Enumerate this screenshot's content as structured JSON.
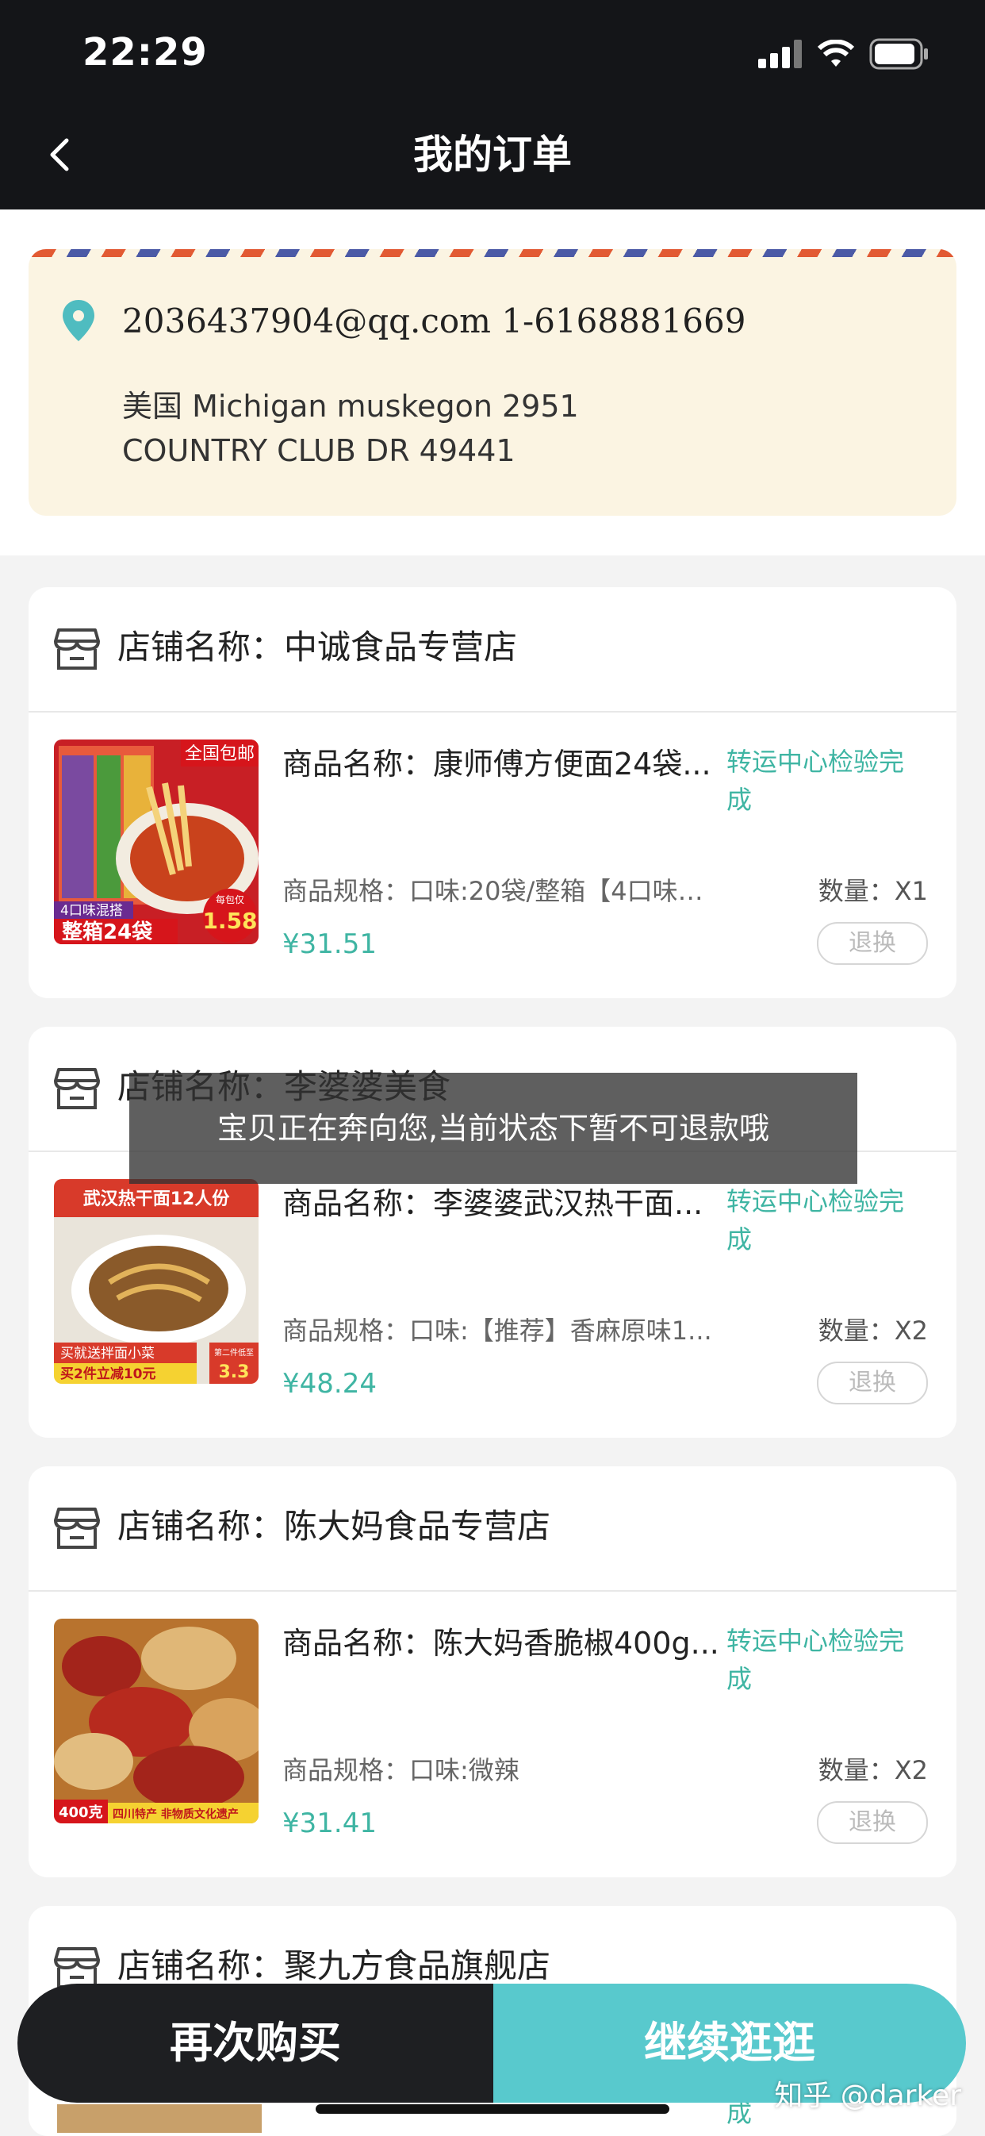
{
  "status_bar": {
    "time": "22:29"
  },
  "header": {
    "title": "我的订单"
  },
  "address": {
    "contact": "2036437904@qq.com 1-6168881669",
    "line1": "美国 Michigan muskegon 2951",
    "line2": "COUNTRY CLUB DR 49441"
  },
  "shops": [
    {
      "shop_label": "店铺名称：中诚食品专营店",
      "product_name": "商品名称：康师傅方便面24袋...",
      "status": "转运中心检验完成",
      "spec": "商品规格：口味:20袋/整箱【4口味混...",
      "quantity": "数量：X1",
      "price": "¥31.51",
      "refund_label": "退换"
    },
    {
      "shop_label": "店铺名称：李婆婆美食",
      "product_name": "商品名称：李婆婆武汉热干面...",
      "status": "转运中心检验完成",
      "spec": "商品规格：口味:【推荐】香麻原味1...",
      "quantity": "数量：X2",
      "price": "¥48.24",
      "refund_label": "退换"
    },
    {
      "shop_label": "店铺名称：陈大妈食品专营店",
      "product_name": "商品名称：陈大妈香脆椒400g...",
      "status": "转运中心检验完成",
      "spec": "商品规格：口味:微辣",
      "quantity": "数量：X2",
      "price": "¥31.41",
      "refund_label": "退换"
    },
    {
      "shop_label": "店铺名称：聚九方食品旗舰店",
      "status_fragment": "成"
    }
  ],
  "product_images": {
    "img1": {
      "badge_top": "全国包邮",
      "badge_bottom": "整箱24袋",
      "corner": "4口味混搭",
      "price_tag": "1.58",
      "price_small": "每包仅"
    },
    "img2": {
      "banner": "武汉热干面12人份",
      "promo1": "买就送拌面小菜",
      "promo2": "买2件立减10元",
      "corner": "第二件低至",
      "corner_price": "3.3"
    },
    "img3": {
      "weight": "400克",
      "tags": "四川特产 非物质文化遗产"
    }
  },
  "toast": {
    "message": "宝贝正在奔向您,当前状态下暂不可退款哦"
  },
  "bottom": {
    "rebuy_label": "再次购买",
    "continue_label": "继续逛逛"
  },
  "watermark": "知乎 @darker",
  "colors": {
    "accent": "#3fb5a3",
    "header_bg": "#141518",
    "continue_bg": "#58c9cd",
    "rebuy_bg": "#1e1f22",
    "address_bg": "#fbf4e2"
  }
}
